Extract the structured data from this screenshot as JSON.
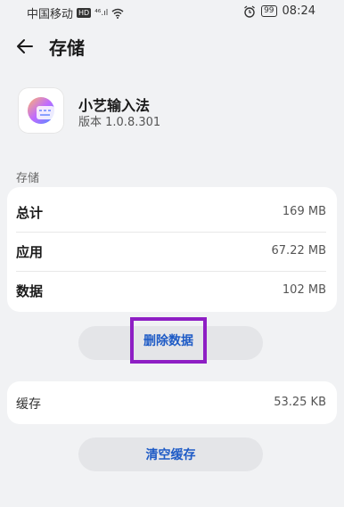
{
  "status_bar": {
    "carrier": "中国移动",
    "hd": "HD",
    "signal": "⁴⁶.ıl",
    "battery": "99",
    "time": "08:24"
  },
  "header": {
    "title": "存储"
  },
  "app": {
    "name": "小艺输入法",
    "version": "版本 1.0.8.301"
  },
  "storage": {
    "section_label": "存储",
    "rows": [
      {
        "label": "总计",
        "value": "169 MB"
      },
      {
        "label": "应用",
        "value": "67.22 MB"
      },
      {
        "label": "数据",
        "value": "102 MB"
      }
    ],
    "delete_button": "删除数据"
  },
  "cache": {
    "label": "缓存",
    "value": "53.25 KB",
    "clear_button": "清空缓存"
  },
  "colors": {
    "accent": "#1e5bc6",
    "highlight": "#8e1fc4",
    "background": "#f1f2f4"
  }
}
